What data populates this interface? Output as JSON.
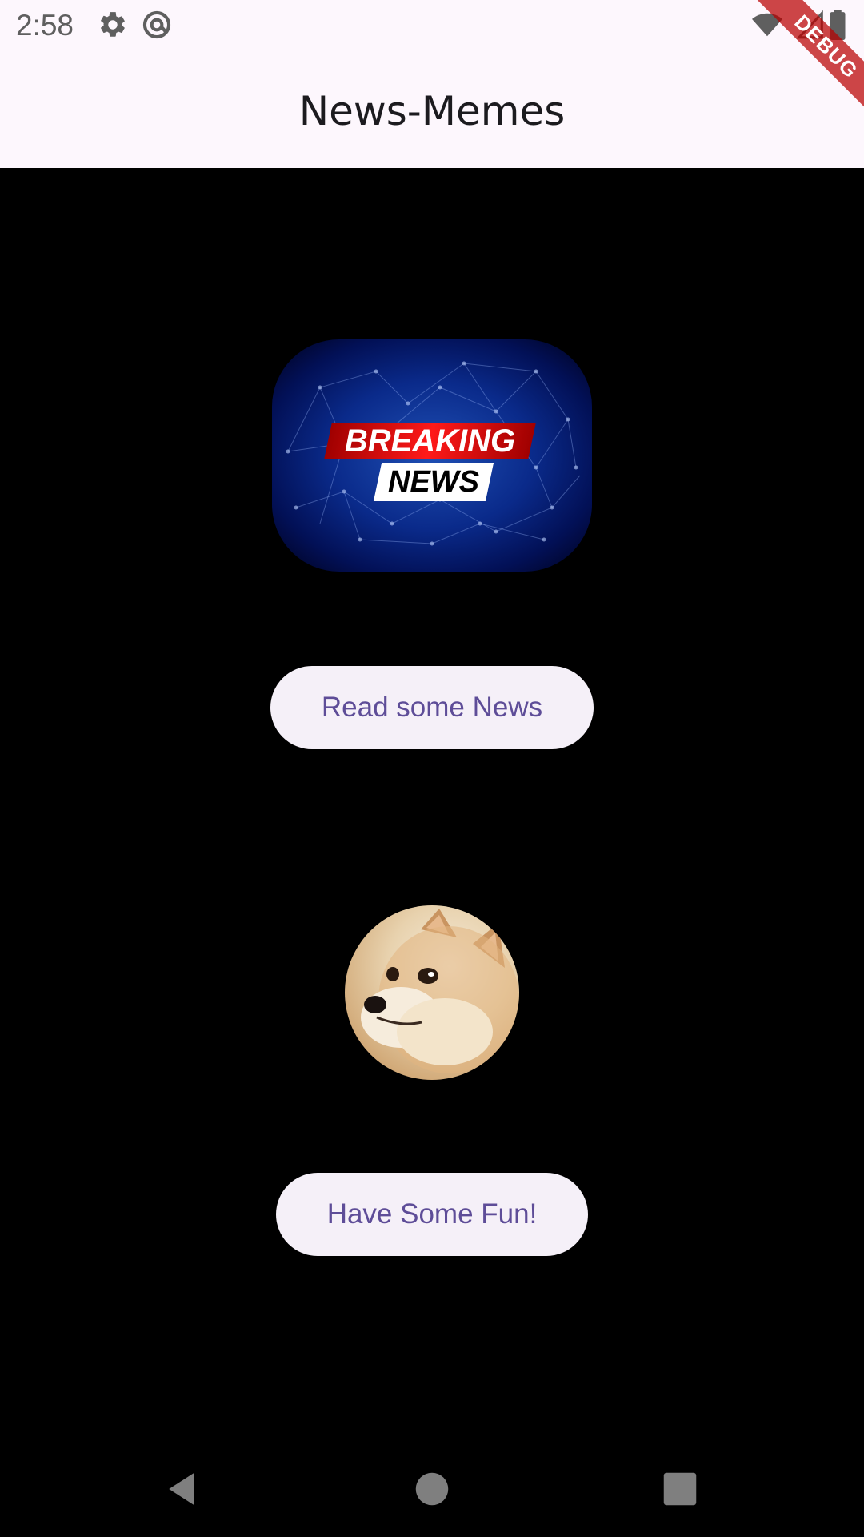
{
  "status_bar": {
    "time": "2:58",
    "icons": [
      "gear-icon",
      "at-sign-icon",
      "wifi-icon",
      "signal-icon",
      "battery-icon"
    ]
  },
  "debug_banner": {
    "label": "DEBUG"
  },
  "app_bar": {
    "title": "News-Memes"
  },
  "news_image": {
    "line1": "BREAKING",
    "line2": "NEWS"
  },
  "news_button": {
    "label": "Read some News"
  },
  "meme_image": {
    "icon": "doge-image"
  },
  "fun_button": {
    "label": "Have Some Fun!"
  },
  "nav_bar": {
    "icons": [
      "back-icon",
      "home-icon",
      "recents-icon"
    ]
  },
  "colors": {
    "app_bar_bg": "#fdf7fd",
    "body_bg": "#000000",
    "button_bg": "#f5f0f8",
    "button_text": "#5e4d98"
  }
}
